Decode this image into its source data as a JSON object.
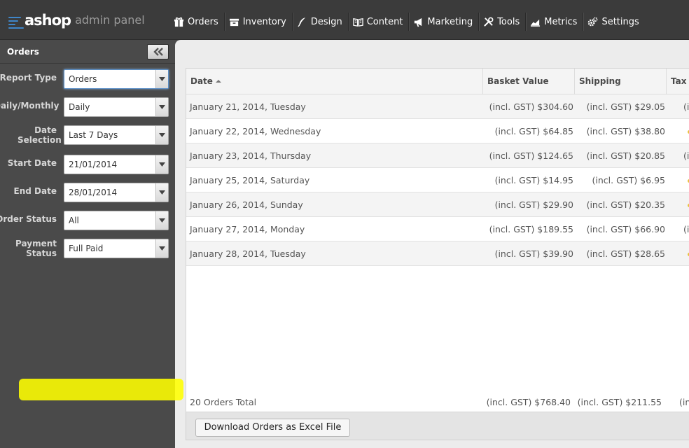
{
  "header": {
    "logo_text": "ashop",
    "logo_subtitle": "admin panel",
    "nav": [
      {
        "label": "Orders",
        "icon": "gift-icon"
      },
      {
        "label": "Inventory",
        "icon": "inventory-icon"
      },
      {
        "label": "Design",
        "icon": "feather-icon"
      },
      {
        "label": "Content",
        "icon": "book-icon"
      },
      {
        "label": "Marketing",
        "icon": "megaphone-icon"
      },
      {
        "label": "Tools",
        "icon": "tools-icon"
      },
      {
        "label": "Metrics",
        "icon": "chart-icon"
      },
      {
        "label": "Settings",
        "icon": "gear-icon"
      }
    ]
  },
  "sidebar": {
    "title": "Orders",
    "collapse_icon": "double-chevron-left-icon",
    "filters": [
      {
        "label": "Report Type",
        "value": "Orders"
      },
      {
        "label": "Daily/Monthly",
        "value": "Daily"
      },
      {
        "label": "Date Selection",
        "value": "Last 7 Days"
      },
      {
        "label": "Start Date",
        "value": "21/01/2014"
      },
      {
        "label": "End Date",
        "value": "28/01/2014"
      },
      {
        "label": "Order Status",
        "value": "All"
      },
      {
        "label": "Payment Status",
        "value": "Full Paid"
      }
    ]
  },
  "table": {
    "columns": [
      "Date",
      "Basket Value",
      "Shipping",
      "Tax"
    ],
    "sort_column": "Date",
    "rows": [
      {
        "date": "January 21, 2014, Tuesday",
        "basket": "(incl. GST) $304.60",
        "shipping": "(incl. GST) $29.05",
        "tax": "(i"
      },
      {
        "date": "January 22, 2014, Wednesday",
        "basket": "(incl. GST) $64.85",
        "shipping": "(incl. GST) $38.80",
        "tax": ""
      },
      {
        "date": "January 23, 2014, Thursday",
        "basket": "(incl. GST) $124.65",
        "shipping": "(incl. GST) $20.85",
        "tax": "(i"
      },
      {
        "date": "January 25, 2014, Saturday",
        "basket": "(incl. GST) $14.95",
        "shipping": "(incl. GST) $6.95",
        "tax": ""
      },
      {
        "date": "January 26, 2014, Sunday",
        "basket": "(incl. GST) $29.90",
        "shipping": "(incl. GST) $20.35",
        "tax": ""
      },
      {
        "date": "January 27, 2014, Monday",
        "basket": "(incl. GST) $189.55",
        "shipping": "(incl. GST) $66.90",
        "tax": "(i"
      },
      {
        "date": "January 28, 2014, Tuesday",
        "basket": "(incl. GST) $39.90",
        "shipping": "(incl. GST) $28.65",
        "tax": ""
      }
    ],
    "total": {
      "label": "20 Orders Total",
      "basket": "(incl. GST) $768.40",
      "shipping": "(incl. GST) $211.55",
      "tax": "(in"
    }
  },
  "actions": {
    "download_label": "Download Orders as Excel File",
    "highlight_color": "#ffff00"
  },
  "colors": {
    "accent": "#3f86c9",
    "topbar": "#3b3b3b",
    "sidebar": "#4a4a4a"
  }
}
